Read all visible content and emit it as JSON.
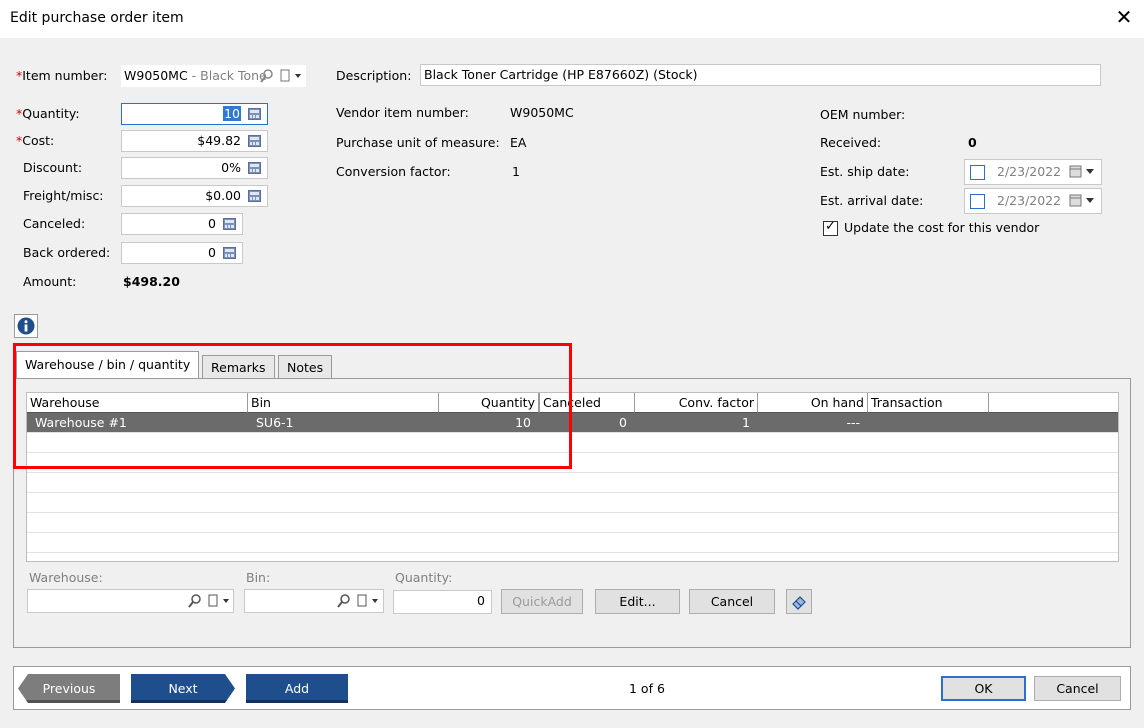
{
  "window": {
    "title": "Edit purchase order item",
    "close_glyph": "✕"
  },
  "left_fields": {
    "required_mark": "*",
    "item_number_label": "Item number:",
    "item_number_value": "W9050MC",
    "item_number_desc": " - Black Tone",
    "quantity_label": "Quantity:",
    "quantity_value": "10",
    "cost_label": "Cost:",
    "cost_value": "$49.82",
    "discount_label": "Discount:",
    "discount_value": "0%",
    "freight_label": "Freight/misc:",
    "freight_value": "$0.00",
    "canceled_label": "Canceled:",
    "canceled_value": "0",
    "back_ordered_label": "Back ordered:",
    "back_ordered_value": "0",
    "amount_label": "Amount:",
    "amount_value": "$498.20"
  },
  "middle_fields": {
    "description_label": "Description:",
    "description_value": "Black Toner Cartridge (HP E87660Z) (Stock)",
    "vendor_item_label": "Vendor item number:",
    "vendor_item_value": "W9050MC",
    "uom_label": "Purchase unit of measure:",
    "uom_value": "EA",
    "conversion_label": "Conversion factor:",
    "conversion_value": "1"
  },
  "right_fields": {
    "oem_label": "OEM number:",
    "received_label": "Received:",
    "received_value": "0",
    "ship_label": "Est. ship date:",
    "ship_value": "2/23/2022",
    "arrival_label": "Est. arrival date:",
    "arrival_value": "2/23/2022",
    "update_cost_label": "Update the cost for this vendor",
    "update_cost_checked": true
  },
  "info_icon": "i",
  "tabs": [
    {
      "label": "Warehouse / bin / quantity",
      "active": true
    },
    {
      "label": "Remarks",
      "active": false
    },
    {
      "label": "Notes",
      "active": false
    }
  ],
  "grid": {
    "columns": [
      "Warehouse",
      "Bin",
      "Quantity",
      "Canceled",
      "Conv. factor",
      "On hand",
      "Transaction"
    ],
    "rows": [
      {
        "warehouse": "Warehouse #1",
        "bin": "SU6-1",
        "quantity": "10",
        "canceled": "0",
        "conv_factor": "1",
        "on_hand": "---",
        "transaction": ""
      }
    ]
  },
  "entry": {
    "warehouse_label": "Warehouse:",
    "bin_label": "Bin:",
    "quantity_label": "Quantity:",
    "quantity_value": "0",
    "quickadd_label": "QuickAdd",
    "edit_label": "Edit...",
    "cancel_label": "Cancel"
  },
  "footer": {
    "previous_label": "Previous",
    "next_label": "Next",
    "add_label": "Add",
    "page_indicator": "1 of 6",
    "ok_label": "OK",
    "cancel_label": "Cancel"
  },
  "colors": {
    "accent": "#1f4e8c",
    "required": "#d00000",
    "highlight": "#ff0000",
    "selection_row": "#6b6b6b"
  }
}
